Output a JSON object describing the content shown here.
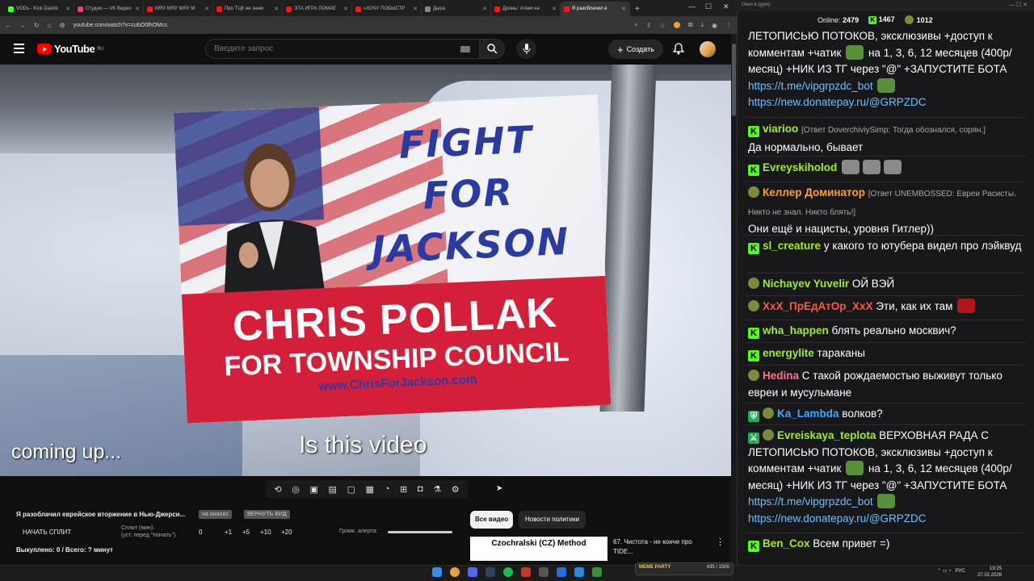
{
  "browser": {
    "tabs": [
      {
        "label": "VODs - Kick Dashb",
        "color": "#53fc18"
      },
      {
        "label": "Студия — VK Видео",
        "color": "#e94560"
      },
      {
        "label": "MЯУ MЯУ MЯУ M",
        "color": "#e61e1e"
      },
      {
        "label": "Про ТЦК не знаю",
        "color": "#e61e1e"
      },
      {
        "label": "ЭТА ИГРА ЛОМАЕ",
        "color": "#e61e1e"
      },
      {
        "label": "«ХОЧУ ПОБЫСТР",
        "color": "#e61e1e"
      },
      {
        "label": "Дыра",
        "color": "#888888"
      },
      {
        "label": "Дроны: Атаки на",
        "color": "#e61e1e"
      },
      {
        "label": "Я разоблачил е",
        "color": "#e61e1e"
      }
    ],
    "url": "youtube.com/watch?v=cubO0lhOMcs",
    "new_tab": "+",
    "win_min": "—",
    "win_max": "☐",
    "win_close": "✕"
  },
  "youtube": {
    "logo_text": "YouTube",
    "logo_region": "RU",
    "search_placeholder": "Введите запрос",
    "create_label": "Создать"
  },
  "video": {
    "sign_slogan_1": "FIGHT",
    "sign_slogan_2": "FOR",
    "sign_slogan_3": "JACKSON",
    "sign_name": "CHRIS POLLAK",
    "sign_council": "FOR TOWNSHIP COUNCIL",
    "sign_site": "www.ChrisForJackson.com",
    "caption_left": "coming up...",
    "caption_center": "Is this video"
  },
  "below": {
    "title": "Я разоблачил еврейское вторжение в Нью-Джерси...",
    "chip1": "на анализ",
    "chip2": "ВЕРНУТЬ ВИД",
    "split_button": "НАЧАТЬ СПЛИТ",
    "split_label_1": "Сплит (мин):",
    "split_label_2": "(уст. перед \"Начать\")",
    "nums": [
      "0",
      "+1",
      "+5",
      "+10",
      "+20"
    ],
    "alert_label": "Громк. алерта:",
    "stats": "Выкуплено: 0 / Всего: ? минут",
    "pill_all": "Все видео",
    "pill_politics": "Новости политики",
    "thumb_text": "Czochralski (CZ) Method",
    "rec_title": "67. Чистота - не конче про TIDE...",
    "rec_menu": "⋮"
  },
  "chat": {
    "window_title": "Окно в дурку",
    "online_label": "Online:",
    "online_count": "2479",
    "kick_count": "1467",
    "other_count": "1012",
    "messages": [
      {
        "text_1": "ЛЕТОПИСЬЮ ПОТОКОВ, эксклюзивы +доступ к комментам +чатик",
        "text_2": "на 1, 3, 6, 12 месяцев (400р/месяц) +НИК ИЗ ТГ через \"@\" +ЗАПУСТИТЕ БОТА",
        "link_1": "https://t.me/vipgrpzdc_bot",
        "link_2": "https://new.donatepay.ru/@GRPZDC"
      },
      {
        "user": "viarioo",
        "color": "#9ef01a",
        "reply": "[Ответ DoverchiviySimp: Тогда обознался, сорян.]",
        "text": "Да нормально, бывает"
      },
      {
        "user": "Evreyskiholod",
        "color": "#9ef01a"
      },
      {
        "user": "Келлер Доминатор",
        "color": "#f5a623",
        "reply": "[Ответ UNEMBOSSED: Евреи Расисты. Никто не знал. Никто блять!]",
        "text": "Они ещё и нацисты, уровня Гитлер))"
      },
      {
        "user": "sl_creature",
        "color": "#9ef01a",
        "text": "у какого то ютубера видел про лэйквуд"
      },
      {
        "user": "Nichayev Yuvelir",
        "color": "#9ef01a",
        "text": "ОЙ ВЭЙ"
      },
      {
        "user": "XxX_ПрЕдАтОр_XxX",
        "color": "#ff5a3c",
        "text": "Эти, как их там"
      },
      {
        "user": "wha_happen",
        "color": "#9ef01a",
        "text": "блять реально москвич?"
      },
      {
        "user": "energylite",
        "color": "#9ef01a",
        "text": "тараканы"
      },
      {
        "user": "Hedina",
        "color": "#ff6f8a",
        "text": "С такой рождаемостью выживут только евреи и мусульмане"
      },
      {
        "user": "Ka_Lambda",
        "color": "#45a6ff",
        "text": "волков?"
      },
      {
        "user": "Evreiskaya_teplota",
        "color": "#9ef01a",
        "text": "ВЕРХОВНАЯ РАДА С ЛЕТОПИСЬЮ ПОТОКОВ, эксклюзивы +доступ к комментам +чатик",
        "text_2": "на 1, 3, 6, 12 месяцев (400р/месяц) +НИК ИЗ ТГ через \"@\" +ЗАПУСТИТЕ БОТА",
        "link_1": "https://t.me/vipgrpzdc_bot",
        "link_2": "https://new.donatepay.ru/@GRPZDC"
      },
      {
        "user": "Ben_Cox",
        "color": "#9ef01a",
        "text": "Всем привет =)"
      }
    ]
  },
  "taskbar": {
    "meme_label": "MEME PARTY",
    "meme_count": "435 / 1500",
    "lang": "РУС",
    "time": "19:25",
    "date": "27.02.2026"
  }
}
